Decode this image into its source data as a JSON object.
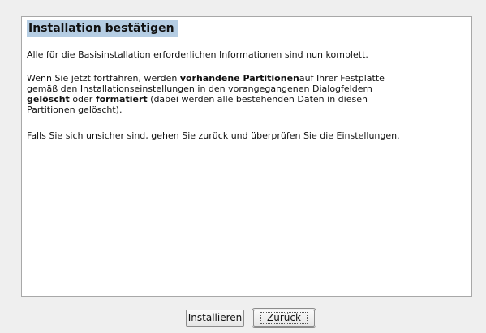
{
  "dialog": {
    "title": "Installation bestätigen",
    "paragraph1": "Alle für die Basisinstallation erforderlichen Informationen sind nun komplett.",
    "paragraph2": {
      "line1_pre": "Wenn Sie jetzt fortfahren, werden ",
      "line1_bold": "vorhandene Partitionen",
      "line1_post": "auf Ihrer Festplatte",
      "line2": "gemäß den Installationseinstellungen in den vorangegangenen Dialogfeldern",
      "line3_bold1": "gelöscht",
      "line3_mid": " oder ",
      "line3_bold2": "formatiert",
      "line3_post": " (dabei werden alle bestehenden Daten in diesen",
      "line4": "Partitionen gelöscht)."
    },
    "paragraph3": "Falls Sie sich unsicher sind, gehen Sie zurück und überprüfen Sie die Einstellungen."
  },
  "buttons": {
    "install": {
      "mnemonic": "I",
      "rest": "nstallieren"
    },
    "back": {
      "mnemonic": "Z",
      "rest": "urück"
    }
  }
}
